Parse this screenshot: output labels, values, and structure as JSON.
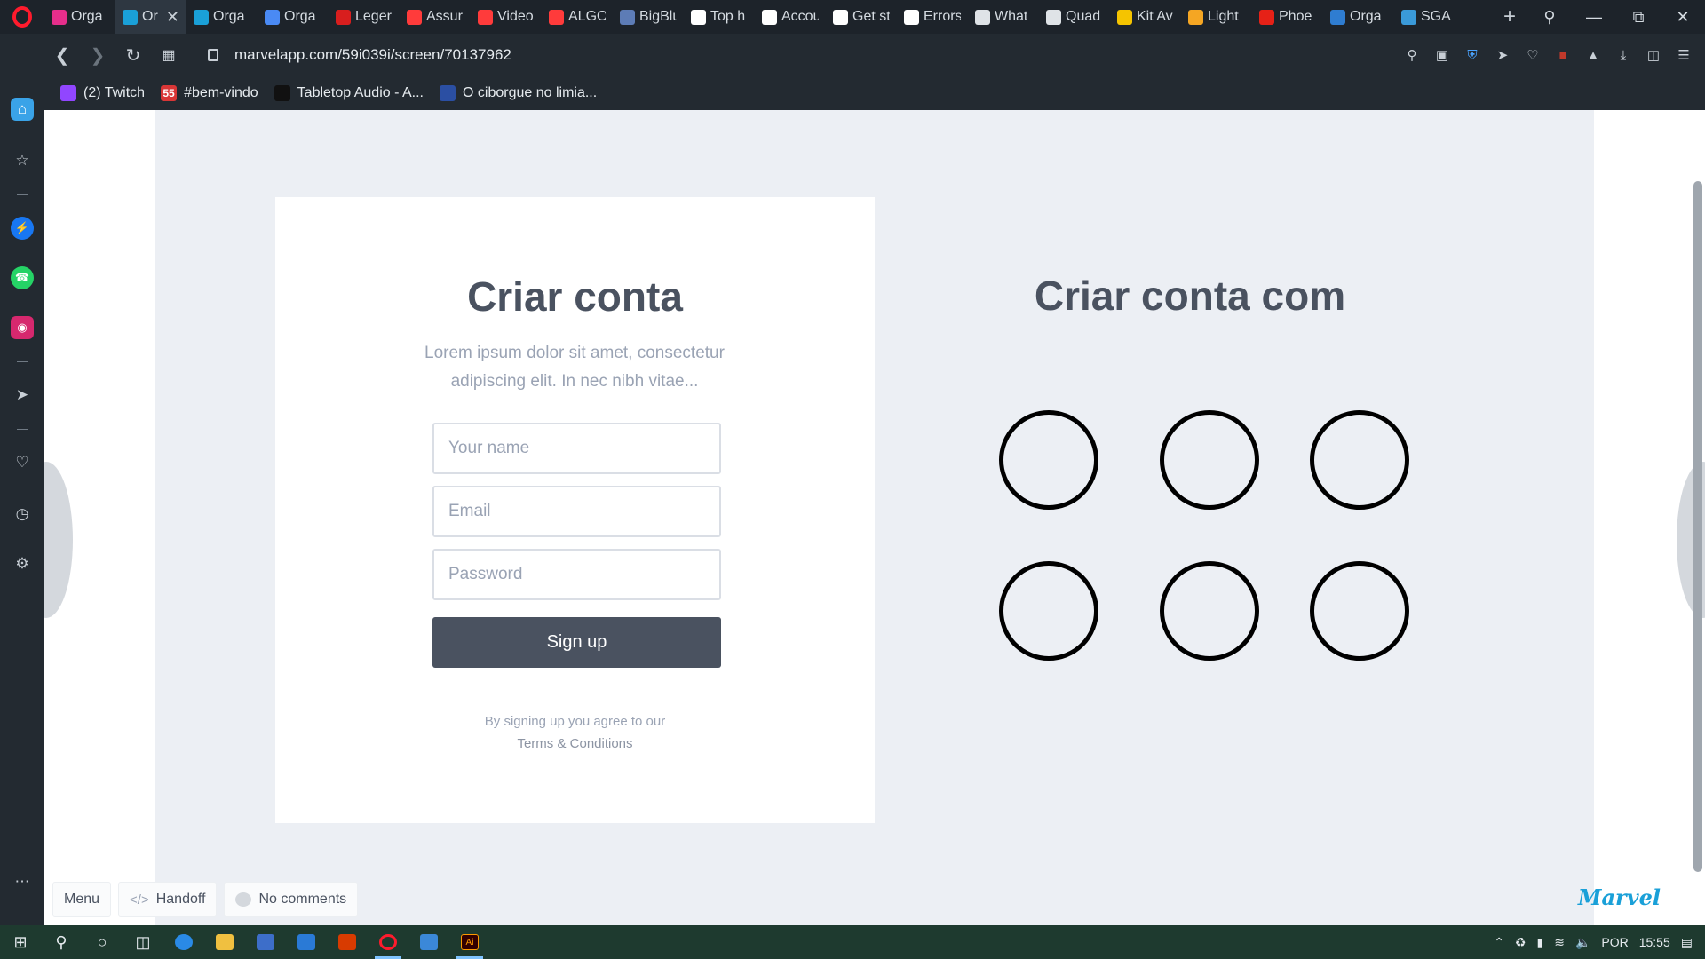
{
  "browser": {
    "tabs": [
      {
        "label": "Orga",
        "icon": "marvel-icon",
        "color": "#e62e8b",
        "active": false
      },
      {
        "label": "Or",
        "icon": "marvel-icon",
        "color": "#1aa0d8",
        "active": true
      },
      {
        "label": "Orga",
        "icon": "marvel-icon",
        "color": "#1aa0d8",
        "active": false
      },
      {
        "label": "Orga",
        "icon": "docs-icon",
        "color": "#4a8af4",
        "active": false
      },
      {
        "label": "Leger",
        "icon": "b-icon",
        "color": "#d81e1e",
        "active": false
      },
      {
        "label": "Assur",
        "icon": "circle-icon",
        "color": "#ff3b3b",
        "active": false
      },
      {
        "label": "Video",
        "icon": "circle-icon",
        "color": "#ff3b3b",
        "active": false
      },
      {
        "label": "ALGO",
        "icon": "circle-icon",
        "color": "#ff3b3b",
        "active": false
      },
      {
        "label": "BigBlu",
        "icon": "bigblue-icon",
        "color": "#5d7cb6",
        "active": false
      },
      {
        "label": "Top h",
        "icon": "notion-icon",
        "color": "#ffffff",
        "active": false
      },
      {
        "label": "Accou",
        "icon": "notion-icon",
        "color": "#ffffff",
        "active": false
      },
      {
        "label": "Get st",
        "icon": "notion-icon",
        "color": "#ffffff",
        "active": false
      },
      {
        "label": "Errors",
        "icon": "notion-icon",
        "color": "#ffffff",
        "active": false
      },
      {
        "label": "What",
        "icon": "document-icon",
        "color": "#dfe3e7",
        "active": false
      },
      {
        "label": "Quad",
        "icon": "document-icon",
        "color": "#dfe3e7",
        "active": false
      },
      {
        "label": "Kit Av",
        "icon": "bolt-icon",
        "color": "#f5c400",
        "active": false
      },
      {
        "label": "Light",
        "icon": "grid-icon",
        "color": "#f5a623",
        "active": false
      },
      {
        "label": "Phoe",
        "icon": "youtube-icon",
        "color": "#e62117",
        "active": false
      },
      {
        "label": "Orga",
        "icon": "trello-icon",
        "color": "#2f7dd1",
        "active": false
      },
      {
        "label": "SGA",
        "icon": "sga-icon",
        "color": "#3a9ad9",
        "active": false
      }
    ],
    "url": "marvelapp.com/59i039i/screen/70137962",
    "bookmarks": [
      {
        "label": "(2) Twitch",
        "icon": "twitch-icon",
        "color": "#9146ff"
      },
      {
        "label": "#bem-vindo",
        "icon": "discord-icon",
        "color": "#d93636",
        "badge": "55"
      },
      {
        "label": "Tabletop Audio - A...",
        "icon": "tabletop-icon",
        "color": "#111111"
      },
      {
        "label": "O ciborgue no limia...",
        "icon": "e-icon",
        "color": "#2b4fa3"
      }
    ]
  },
  "signup": {
    "title": "Criar conta",
    "description": "Lorem ipsum dolor sit amet, consectetur adipiscing elit. In nec nibh vitae...",
    "name_placeholder": "Your name",
    "email_placeholder": "Email",
    "password_placeholder": "Password",
    "button_label": "Sign up",
    "terms_line1": "By signing up you agree to our",
    "terms_link": "Terms & Conditions"
  },
  "alternatives": {
    "title": "Criar conta com",
    "circle_count": 6
  },
  "marvel_bar": {
    "menu": "Menu",
    "handoff": "Handoff",
    "comments": "No comments",
    "logo": "Marvel"
  },
  "taskbar": {
    "language": "POR",
    "time": "15:55"
  }
}
